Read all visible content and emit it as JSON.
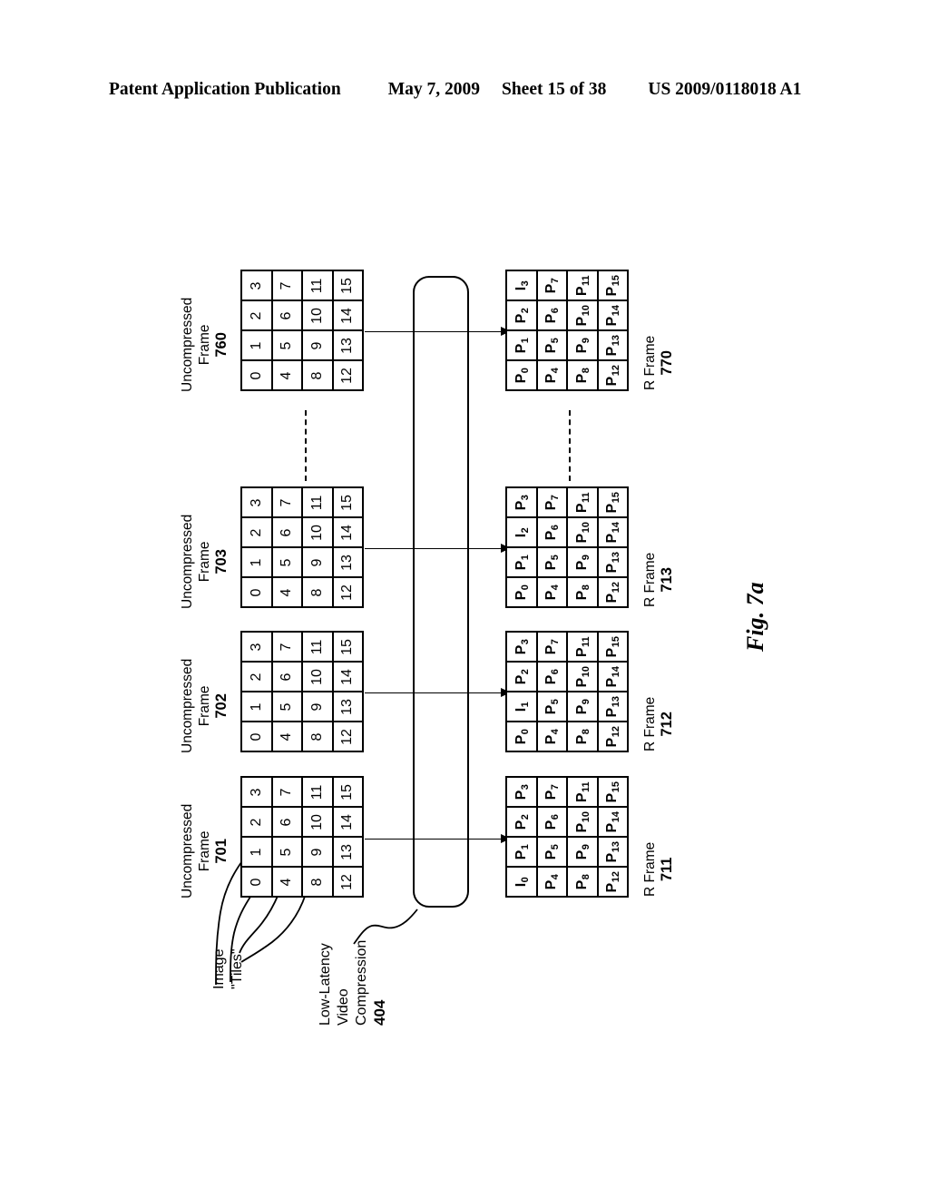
{
  "header": {
    "publication": "Patent Application Publication",
    "date": "May 7, 2009",
    "sheet": "Sheet 15 of 38",
    "patent_number": "US 2009/0118018 A1"
  },
  "figure": {
    "label": "Fig. 7a",
    "compression_block": {
      "line1": "Low-Latency",
      "line2": "Video",
      "line3": "Compression",
      "ref": "404"
    },
    "tiles_annotation": {
      "line1": "Image",
      "line2": "\"Tiles\""
    },
    "ellipsis_symbol": "vertical-dashed-ellipsis",
    "uncompressed_frames": [
      {
        "caption_line1": "Uncompressed",
        "caption_line2": "Frame",
        "ref": "701",
        "tiles": [
          "0",
          "1",
          "2",
          "3",
          "4",
          "5",
          "6",
          "7",
          "8",
          "9",
          "10",
          "11",
          "12",
          "13",
          "14",
          "15"
        ]
      },
      {
        "caption_line1": "Uncompressed",
        "caption_line2": "Frame",
        "ref": "702",
        "tiles": [
          "0",
          "1",
          "2",
          "3",
          "4",
          "5",
          "6",
          "7",
          "8",
          "9",
          "10",
          "11",
          "12",
          "13",
          "14",
          "15"
        ]
      },
      {
        "caption_line1": "Uncompressed",
        "caption_line2": "Frame",
        "ref": "703",
        "tiles": [
          "0",
          "1",
          "2",
          "3",
          "4",
          "5",
          "6",
          "7",
          "8",
          "9",
          "10",
          "11",
          "12",
          "13",
          "14",
          "15"
        ]
      },
      {
        "caption_line1": "Uncompressed",
        "caption_line2": "Frame",
        "ref": "760",
        "tiles": [
          "0",
          "1",
          "2",
          "3",
          "4",
          "5",
          "6",
          "7",
          "8",
          "9",
          "10",
          "11",
          "12",
          "13",
          "14",
          "15"
        ]
      }
    ],
    "r_frames": [
      {
        "caption_line1": "R Frame",
        "ref": "711",
        "tiles": [
          {
            "t": "I",
            "s": "0"
          },
          {
            "t": "P",
            "s": "1"
          },
          {
            "t": "P",
            "s": "2"
          },
          {
            "t": "P",
            "s": "3"
          },
          {
            "t": "P",
            "s": "4"
          },
          {
            "t": "P",
            "s": "5"
          },
          {
            "t": "P",
            "s": "6"
          },
          {
            "t": "P",
            "s": "7"
          },
          {
            "t": "P",
            "s": "8"
          },
          {
            "t": "P",
            "s": "9"
          },
          {
            "t": "P",
            "s": "10"
          },
          {
            "t": "P",
            "s": "11"
          },
          {
            "t": "P",
            "s": "12"
          },
          {
            "t": "P",
            "s": "13"
          },
          {
            "t": "P",
            "s": "14"
          },
          {
            "t": "P",
            "s": "15"
          }
        ]
      },
      {
        "caption_line1": "R Frame",
        "ref": "712",
        "tiles": [
          {
            "t": "P",
            "s": "0"
          },
          {
            "t": "I",
            "s": "1"
          },
          {
            "t": "P",
            "s": "2"
          },
          {
            "t": "P",
            "s": "3"
          },
          {
            "t": "P",
            "s": "4"
          },
          {
            "t": "P",
            "s": "5"
          },
          {
            "t": "P",
            "s": "6"
          },
          {
            "t": "P",
            "s": "7"
          },
          {
            "t": "P",
            "s": "8"
          },
          {
            "t": "P",
            "s": "9"
          },
          {
            "t": "P",
            "s": "10"
          },
          {
            "t": "P",
            "s": "11"
          },
          {
            "t": "P",
            "s": "12"
          },
          {
            "t": "P",
            "s": "13"
          },
          {
            "t": "P",
            "s": "14"
          },
          {
            "t": "P",
            "s": "15"
          }
        ]
      },
      {
        "caption_line1": "R Frame",
        "ref": "713",
        "tiles": [
          {
            "t": "P",
            "s": "0"
          },
          {
            "t": "P",
            "s": "1"
          },
          {
            "t": "I",
            "s": "2"
          },
          {
            "t": "P",
            "s": "3"
          },
          {
            "t": "P",
            "s": "4"
          },
          {
            "t": "P",
            "s": "5"
          },
          {
            "t": "P",
            "s": "6"
          },
          {
            "t": "P",
            "s": "7"
          },
          {
            "t": "P",
            "s": "8"
          },
          {
            "t": "P",
            "s": "9"
          },
          {
            "t": "P",
            "s": "10"
          },
          {
            "t": "P",
            "s": "11"
          },
          {
            "t": "P",
            "s": "12"
          },
          {
            "t": "P",
            "s": "13"
          },
          {
            "t": "P",
            "s": "14"
          },
          {
            "t": "P",
            "s": "15"
          }
        ]
      },
      {
        "caption_line1": "R Frame",
        "ref": "770",
        "tiles": [
          {
            "t": "P",
            "s": "0"
          },
          {
            "t": "P",
            "s": "1"
          },
          {
            "t": "P",
            "s": "2"
          },
          {
            "t": "I",
            "s": "3"
          },
          {
            "t": "P",
            "s": "4"
          },
          {
            "t": "P",
            "s": "5"
          },
          {
            "t": "P",
            "s": "6"
          },
          {
            "t": "P",
            "s": "7"
          },
          {
            "t": "P",
            "s": "8"
          },
          {
            "t": "P",
            "s": "9"
          },
          {
            "t": "P",
            "s": "10"
          },
          {
            "t": "P",
            "s": "11"
          },
          {
            "t": "P",
            "s": "12"
          },
          {
            "t": "P",
            "s": "13"
          },
          {
            "t": "P",
            "s": "14"
          },
          {
            "t": "P",
            "s": "15"
          }
        ]
      }
    ]
  }
}
